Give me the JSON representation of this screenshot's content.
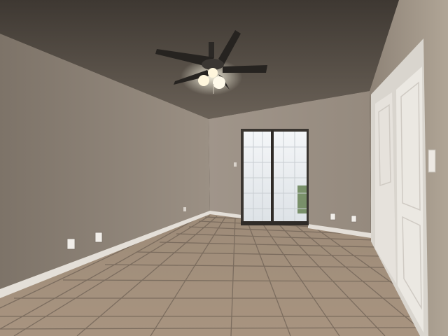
{
  "scene": {
    "subject": "empty-bedroom",
    "colors": {
      "ceiling": "#5e554c",
      "left_wall": "#8f8478",
      "back_wall": "#9a8f83",
      "right_wall": "#a29789",
      "floor_tile": "#a08d78",
      "grout": "#6d5e50",
      "baseboard": "#e8e3dc",
      "door_white": "#e9e6e0",
      "glass_light": "#eef1f4",
      "fan_blade": "#262320",
      "fan_light": "#fff6dc"
    },
    "features": {
      "ceiling_fan": {
        "blades": 4,
        "lights_on": true
      },
      "sliding_glass_door": {
        "panes_columns": 4,
        "panes_rows": 6
      },
      "closet_doors": {
        "count": 2,
        "style": "white bifold"
      },
      "outlets": 4,
      "floor": "ceramic tile"
    }
  }
}
